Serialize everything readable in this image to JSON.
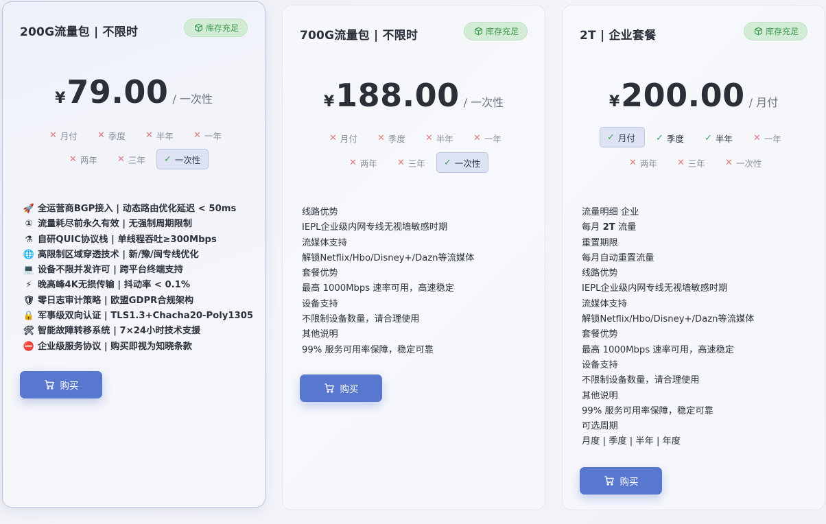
{
  "cards": [
    {
      "title": "200G流量包 | 不限时",
      "badge": "库存充足",
      "currency": "¥",
      "amount": "79.00",
      "period": "/ 一次性",
      "cycles": [
        "月付",
        "季度",
        "半年",
        "一年",
        "两年",
        "三年",
        "一次性"
      ],
      "selected_cycle": "一次性",
      "features": [
        {
          "icon": "rocket-icon",
          "glyph": "🚀",
          "text": "全运营商BGP接入 | 动态路由优化延迟 < 50ms"
        },
        {
          "icon": "number-one-icon",
          "glyph": "①",
          "text": "流量耗尽前永久有效 | 无强制周期限制"
        },
        {
          "icon": "flask-icon",
          "glyph": "⚗",
          "text": "自研QUIC协议栈 | 单线程吞吐≥300Mbps"
        },
        {
          "icon": "globe-icon",
          "glyph": "🌐",
          "text": "高限制区域穿透技术 | 新/豫/闽专线优化"
        },
        {
          "icon": "laptop-icon",
          "glyph": "💻",
          "text": "设备不限并发许可 | 跨平台终端支持"
        },
        {
          "icon": "lightning-icon",
          "glyph": "⚡",
          "text": "晚高峰4K无损传输 | 抖动率 < 0.1%"
        },
        {
          "icon": "shield-icon",
          "glyph": "🛡",
          "text": "零日志审计策略 | 欧盟GDPR合规架构"
        },
        {
          "icon": "lock-icon",
          "glyph": "🔒",
          "text": "军事级双向认证 | TLS1.3+Chacha20-Poly1305"
        },
        {
          "icon": "tools-icon",
          "glyph": "🛠",
          "text": "智能故障转移系统 | 7×24小时技术支援"
        },
        {
          "icon": "no-entry-icon",
          "glyph": "⛔",
          "text": "企业级服务协议 | 购买即视为知晓条款"
        }
      ],
      "buy_label": "购买"
    },
    {
      "title": "700G流量包 | 不限时",
      "badge": "库存充足",
      "currency": "¥",
      "amount": "188.00",
      "period": "/ 一次性",
      "cycles": [
        "月付",
        "季度",
        "半年",
        "一年",
        "两年",
        "三年",
        "一次性"
      ],
      "selected_cycle": "一次性",
      "features": [
        {
          "text": "线路优势"
        },
        {
          "text": "IEPL企业级内网专线无视墙敏感时期"
        },
        {
          "text": "流媒体支持"
        },
        {
          "text": "解锁Netflix/Hbo/Disney+/Dazn等流媒体"
        },
        {
          "text": "套餐优势"
        },
        {
          "text": "最高 1000Mbps 速率可用，高速稳定"
        },
        {
          "text": "设备支持"
        },
        {
          "text": "不限制设备数量，请合理使用"
        },
        {
          "text": "其他说明"
        },
        {
          "text": "99% 服务可用率保障，稳定可靠"
        }
      ],
      "buy_label": "购买"
    },
    {
      "title": "2T | 企业套餐",
      "badge": "库存充足",
      "currency": "¥",
      "amount": "200.00",
      "period": "/ 月付",
      "cycles": [
        "月付",
        "季度",
        "半年",
        "一年",
        "两年",
        "三年",
        "一次性"
      ],
      "selected_cycle": "月付",
      "available_cycles": [
        "月付",
        "季度",
        "半年"
      ],
      "features": [
        {
          "text": "流量明细 企业"
        },
        {
          "text": "每月 2T 流量",
          "bold_part": "2T"
        },
        {
          "text": "重置期限"
        },
        {
          "text": "每月自动重置流量"
        },
        {
          "text": "线路优势"
        },
        {
          "text": "IEPL企业级内网专线无视墙敏感时期"
        },
        {
          "text": "流媒体支持"
        },
        {
          "text": "解锁Netflix/Hbo/Disney+/Dazn等流媒体"
        },
        {
          "text": "套餐优势"
        },
        {
          "text": "最高 1000Mbps 速率可用，高速稳定"
        },
        {
          "text": "设备支持"
        },
        {
          "text": "不限制设备数量，请合理使用"
        },
        {
          "text": "其他说明"
        },
        {
          "text": "99% 服务可用率保障，稳定可靠"
        },
        {
          "text": "可选周期"
        },
        {
          "text": "月度 | 季度 | 半年 | 年度"
        }
      ],
      "buy_label": "购买"
    }
  ],
  "colors": {
    "accent": "#5877cf",
    "badge_bg": "#d3ecd6",
    "badge_text": "#3c9a4c",
    "unavailable_mark": "#e07a7a",
    "available_mark": "#3aa157"
  }
}
